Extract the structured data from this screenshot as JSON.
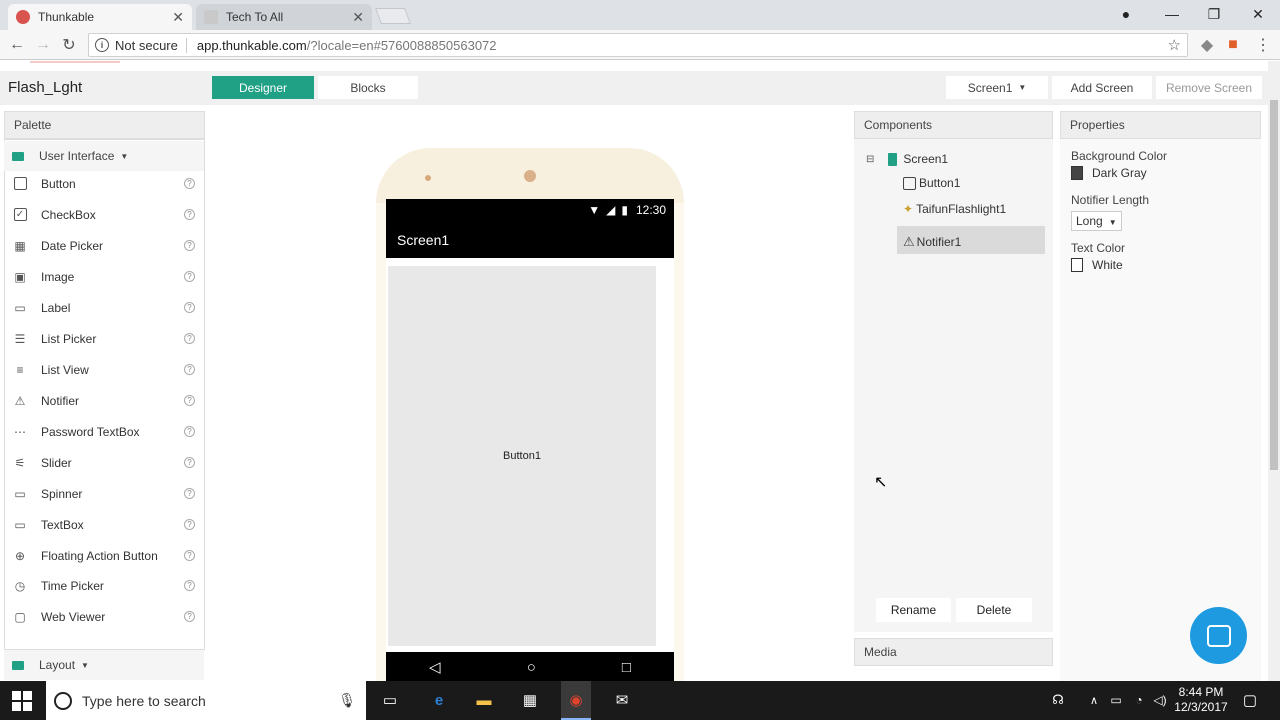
{
  "browser": {
    "tabs": [
      {
        "title": "Thunkable",
        "active": true
      },
      {
        "title": "Tech To All",
        "active": false
      }
    ],
    "security_label": "Not secure",
    "url_host": "app.thunkable.com",
    "url_path": "/?locale=en#5760088850563072",
    "window_controls": {
      "minimize": "—",
      "restore": "❐",
      "close": "✕"
    }
  },
  "toolbar": {
    "project_name": "Flash_Lght",
    "designer_label": "Designer",
    "blocks_label": "Blocks",
    "screen_select": "Screen1",
    "add_screen": "Add Screen",
    "remove_screen": "Remove Screen"
  },
  "palette": {
    "title": "Palette",
    "category": "User Interface",
    "items": [
      {
        "label": "Button",
        "icon": "button-icon"
      },
      {
        "label": "CheckBox",
        "icon": "checkbox-icon"
      },
      {
        "label": "Date Picker",
        "icon": "calendar-icon"
      },
      {
        "label": "Image",
        "icon": "image-icon"
      },
      {
        "label": "Label",
        "icon": "label-icon"
      },
      {
        "label": "List Picker",
        "icon": "list-picker-icon"
      },
      {
        "label": "List View",
        "icon": "list-view-icon"
      },
      {
        "label": "Notifier",
        "icon": "warning-icon"
      },
      {
        "label": "Password TextBox",
        "icon": "password-icon"
      },
      {
        "label": "Slider",
        "icon": "slider-icon"
      },
      {
        "label": "Spinner",
        "icon": "spinner-icon"
      },
      {
        "label": "TextBox",
        "icon": "textbox-icon"
      },
      {
        "label": "Floating Action Button",
        "icon": "plus-circle-icon"
      },
      {
        "label": "Time Picker",
        "icon": "clock-icon"
      },
      {
        "label": "Web Viewer",
        "icon": "browser-icon"
      }
    ],
    "category2": "Layout"
  },
  "phone": {
    "time": "12:30",
    "screen_title": "Screen1",
    "button_text": "Button1"
  },
  "components": {
    "title": "Components",
    "tree": [
      {
        "label": "Screen1",
        "icon": "phone-icon"
      },
      {
        "label": "Button1",
        "icon": "button-icon"
      },
      {
        "label": "TaifunFlashlight1",
        "icon": "flashlight-icon"
      },
      {
        "label": "Notifier1",
        "icon": "warning-icon",
        "selected": true
      }
    ],
    "rename": "Rename",
    "delete": "Delete",
    "media_title": "Media"
  },
  "properties": {
    "title": "Properties",
    "background_color_label": "Background Color",
    "background_color_value": "Dark Gray",
    "background_color_hex": "#444444",
    "notifier_length_label": "Notifier Length",
    "notifier_length_value": "Long",
    "text_color_label": "Text Color",
    "text_color_value": "White",
    "text_color_hex": "#ffffff"
  },
  "taskbar": {
    "search_placeholder": "Type here to search",
    "time": "8:44 PM",
    "date": "12/3/2017"
  },
  "colors": {
    "accent": "#20a085",
    "chat": "#1e9be0"
  }
}
